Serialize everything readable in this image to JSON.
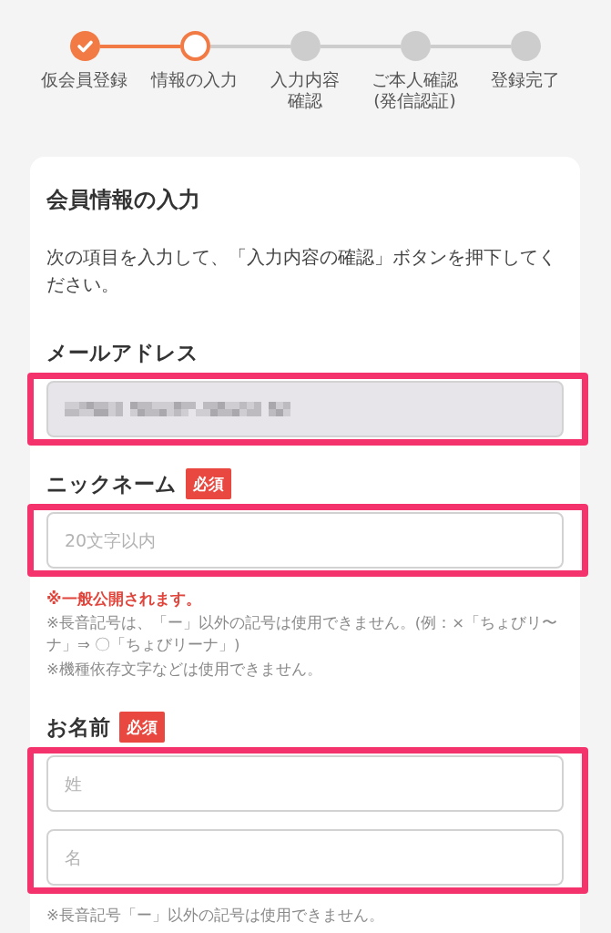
{
  "steps": [
    {
      "lines": [
        "仮会員登録"
      ],
      "completed": true,
      "current": false
    },
    {
      "lines": [
        "情報の入力"
      ],
      "completed": false,
      "current": true
    },
    {
      "lines": [
        "入力内容",
        "確認"
      ],
      "completed": false,
      "current": false
    },
    {
      "lines": [
        "ご本人確認",
        "(発信認証)"
      ],
      "completed": false,
      "current": false
    },
    {
      "lines": [
        "登録完了"
      ],
      "completed": false,
      "current": false
    }
  ],
  "form": {
    "title": "会員情報の入力",
    "intro": "次の項目を入力して、「入力内容の確認」ボタンを押下してください。",
    "fields": [
      {
        "label": "メールアドレス",
        "highlighted": true,
        "inputs": [
          {
            "disabled": true,
            "blurred": true
          }
        ]
      },
      {
        "label": "ニックネーム",
        "badge": "必須",
        "highlighted": true,
        "inputs": [
          {
            "placeholder": "20文字以内",
            "disabled": false,
            "blurred": false
          }
        ],
        "notes": [
          {
            "kind": "warning",
            "text": "※一般公開されます。"
          },
          {
            "kind": "hint",
            "text": "※長音記号は、「ー」以外の記号は使用できません。(例：×「ちょびリ〜ナ」⇒ 〇「ちょびリーナ」)"
          },
          {
            "kind": "hint",
            "text": "※機種依存文字などは使用できません。"
          }
        ]
      },
      {
        "label": "お名前",
        "badge": "必須",
        "highlighted": true,
        "inputs": [
          {
            "placeholder": "姓",
            "disabled": false,
            "blurred": false
          },
          {
            "placeholder": "名",
            "disabled": false,
            "blurred": false
          }
        ],
        "notes": [
          {
            "kind": "hint",
            "text": "※長音記号「ー」以外の記号は使用できません。"
          }
        ]
      }
    ]
  }
}
